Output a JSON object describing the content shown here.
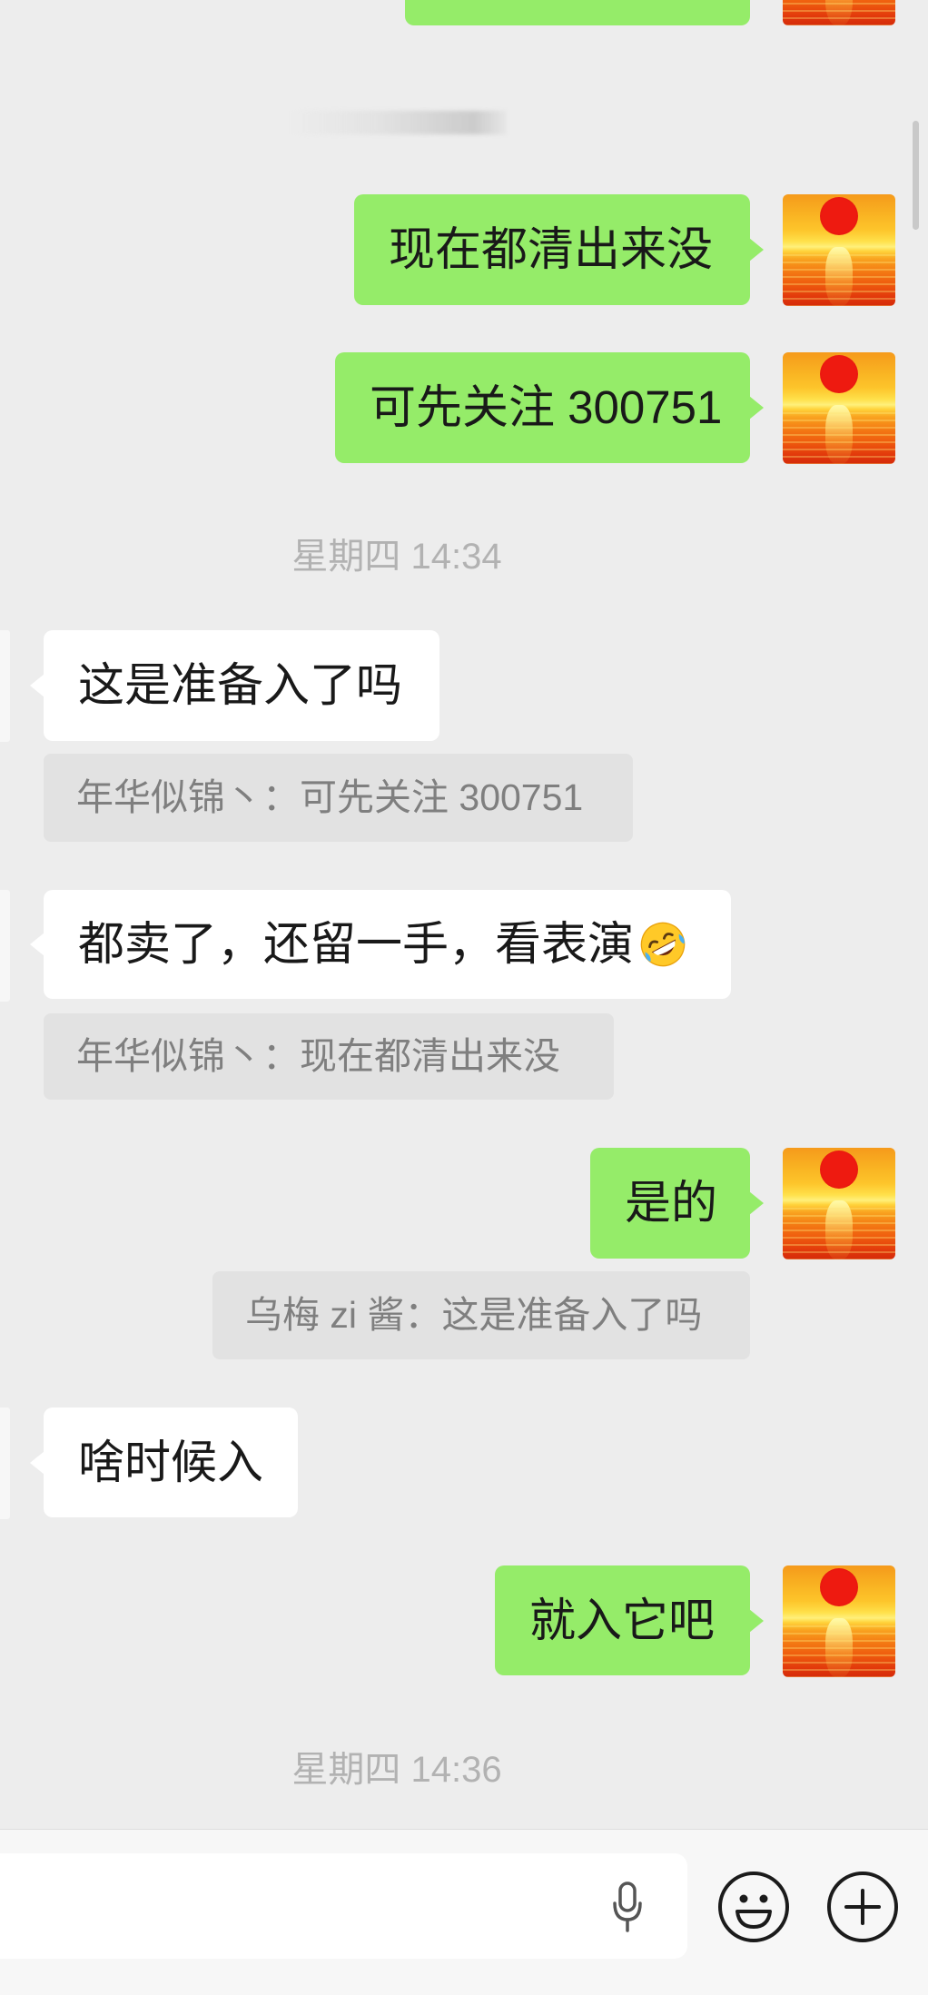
{
  "colors": {
    "chat_bg": "#ededed",
    "self_bubble": "#95ec69",
    "peer_bubble": "#ffffff",
    "quote_bg": "#e2e2e2",
    "quote_text": "#7f7f7f",
    "timestamp_text": "#b2b2b2",
    "message_text": "#191919",
    "input_bar_bg": "#f7f7f7"
  },
  "self_avatar_icon": "sunset-avatar",
  "timestamps": [
    "星期四 14:34",
    "星期四 14:36"
  ],
  "messages": [
    {
      "text": "现在都清出来没"
    },
    {
      "text": "可先关注 300751"
    },
    {
      "text": "这是准备入了吗",
      "quote": "年华似锦丶：可先关注 300751"
    },
    {
      "text": "都卖了，还留一手，看表演",
      "emoji_icon": "rolling-on-floor-laughing-emoji",
      "quote": "年华似锦丶：现在都清出来没"
    },
    {
      "text": "是的",
      "quote": "乌梅 zi 酱：这是准备入了吗"
    },
    {
      "text": "啥时候入"
    },
    {
      "text": "就入它吧"
    }
  ],
  "input_bar": {
    "value": "",
    "voice_icon": "microphone-icon",
    "emoji_icon": "smiley-face-icon",
    "more_icon": "plus-circle-icon"
  }
}
